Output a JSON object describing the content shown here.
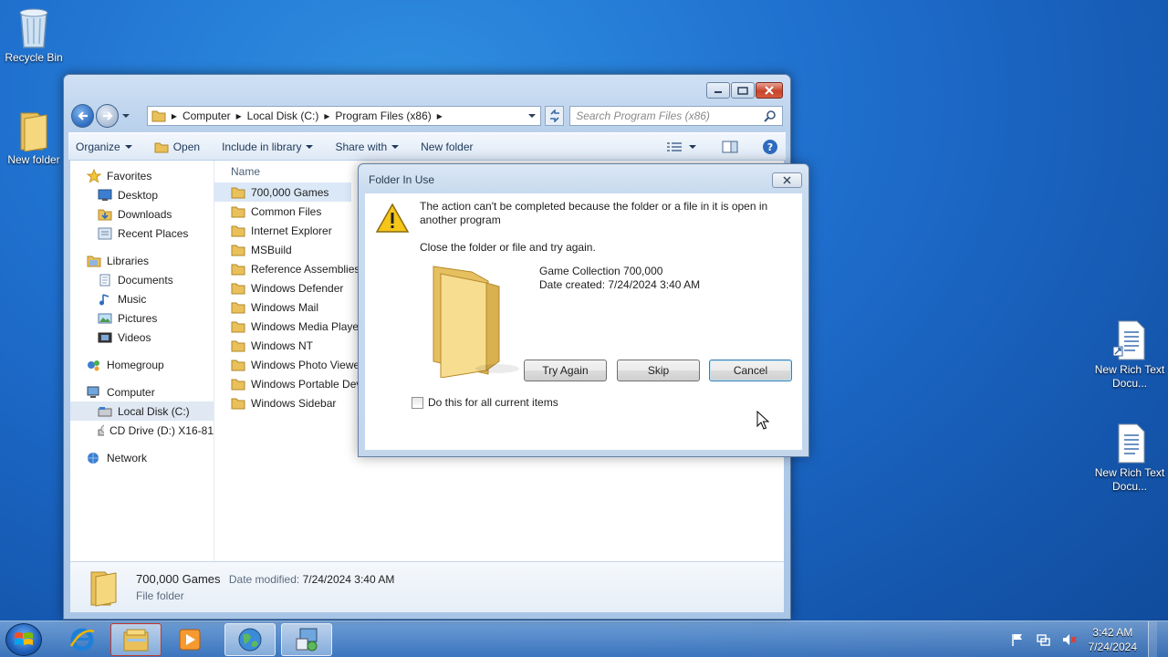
{
  "desktop": {
    "icons": [
      {
        "label": "Recycle Bin",
        "icon": "recycle-bin-icon"
      },
      {
        "label": "New folder",
        "icon": "folder-icon"
      },
      {
        "label": "New Rich Text Docu...",
        "icon": "rtf-document-icon"
      },
      {
        "label": "New Rich Text Docu...",
        "icon": "rtf-document-icon"
      }
    ]
  },
  "explorer": {
    "address": {
      "segments": [
        "Computer",
        "Local Disk (C:)",
        "Program Files (x86)"
      ]
    },
    "search": {
      "placeholder": "Search Program Files (x86)"
    },
    "toolbar": {
      "organize": "Organize",
      "open": "Open",
      "include_in_library": "Include in library",
      "share_with": "Share with",
      "new_folder": "New folder"
    },
    "nav": {
      "favorites": "Favorites",
      "desktop": "Desktop",
      "downloads": "Downloads",
      "recent_places": "Recent Places",
      "libraries": "Libraries",
      "documents": "Documents",
      "music": "Music",
      "pictures": "Pictures",
      "videos": "Videos",
      "homegroup": "Homegroup",
      "computer": "Computer",
      "local_disk": "Local Disk (C:)",
      "cd_drive": "CD Drive (D:) X16-81",
      "network": "Network"
    },
    "files": {
      "column_name": "Name",
      "items": [
        "700,000 Games",
        "Common Files",
        "Internet Explorer",
        "MSBuild",
        "Reference Assemblies",
        "Windows Defender",
        "Windows Mail",
        "Windows Media Player",
        "Windows NT",
        "Windows Photo Viewer",
        "Windows Portable Devices",
        "Windows Sidebar"
      ]
    },
    "details": {
      "name": "700,000 Games",
      "modified_label": "Date modified:",
      "modified_value": "7/24/2024 3:40 AM",
      "type": "File folder"
    }
  },
  "dialog": {
    "title": "Folder In Use",
    "message": "The action can't be completed because the folder or a file in it is open in another program",
    "instruction": "Close the folder or file and try again.",
    "item_name": "Game Collection 700,000",
    "item_date": "Date created: 7/24/2024 3:40 AM",
    "buttons": {
      "try_again": "Try Again",
      "skip": "Skip",
      "cancel": "Cancel"
    },
    "checkbox_label": "Do this for all current items"
  },
  "taskbar": {
    "time": "3:42 AM",
    "date": "7/24/2024"
  },
  "colors": {
    "desktop_blue": "#1f6fce",
    "selection": "#dbe8f7",
    "warning_yellow": "#f5c518",
    "folder_yellow": "#f2d27a"
  }
}
